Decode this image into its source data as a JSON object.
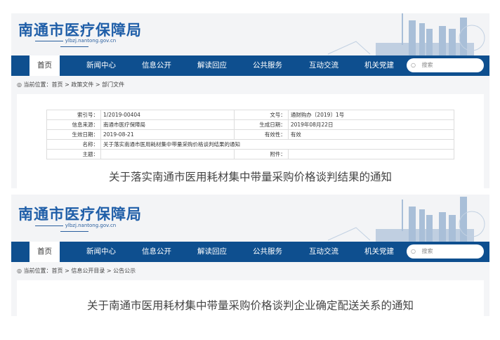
{
  "panels": [
    {
      "site": {
        "title": "南通市医疗保障局",
        "url": "ylbzj.nantong.gov.cn"
      },
      "nav": [
        "首页",
        "新闻中心",
        "信息公开",
        "解读回应",
        "公共服务",
        "互动交流",
        "机关党建"
      ],
      "search_placeholder": "搜索",
      "breadcrumb": "当前位置：首页 > 政策文件 > 部门文件",
      "meta": {
        "index_label": "索引号：",
        "index": "1/2019-00404",
        "docno_label": "文号：",
        "docno": "通财购办〔2019〕1号",
        "source_label": "信息来源：",
        "source": "南通市医疗保障局",
        "created_label": "生成日期：",
        "created": "2019年08月22日",
        "effective_label": "生效日期：",
        "effective": "2019-08-21",
        "validity_label": "有效性：",
        "validity": "有效",
        "name_label": "名称：",
        "name": "关于落实南通市医用耗材集中带量采购价格谈判结果的通知",
        "subject_label": "主题：",
        "attach_label": "附件："
      },
      "doc_title": "关于落实南通市医用耗材集中带量采购价格谈判结果的通知"
    },
    {
      "site": {
        "title": "南通市医疗保障局",
        "url": "ylbzj.nantong.gov.cn"
      },
      "nav": [
        "首页",
        "新闻中心",
        "信息公开",
        "解读回应",
        "公共服务",
        "互动交流",
        "机关党建"
      ],
      "search_placeholder": "搜索",
      "breadcrumb": "当前位置：首页 > 信息公开目录 > 公告公示",
      "doc_title": "关于南通市医用耗材集中带量采购价格谈判企业确定配送关系的通知"
    }
  ],
  "colors": {
    "nav": "#0e4f8f",
    "logo": "#1f5ea8"
  }
}
